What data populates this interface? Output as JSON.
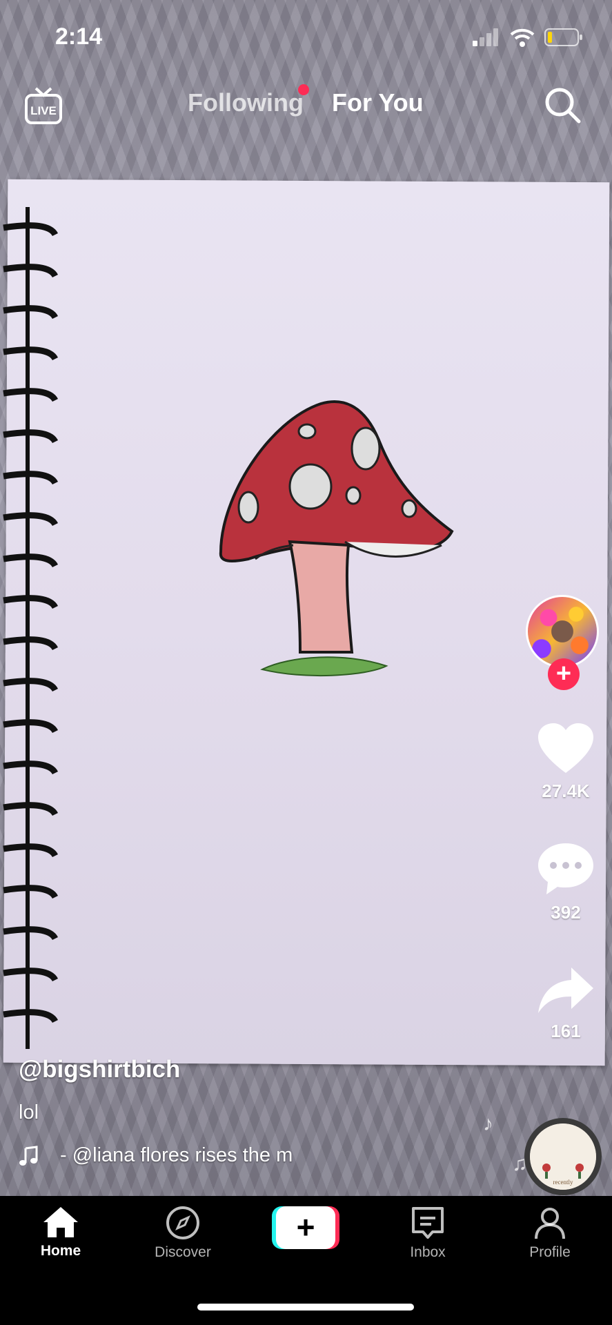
{
  "status_bar": {
    "time": "2:14"
  },
  "top_nav": {
    "live_label": "LIVE",
    "following_label": "Following",
    "for_you_label": "For You"
  },
  "side_actions": {
    "likes": "27.4K",
    "comments": "392",
    "shares": "161"
  },
  "video": {
    "username": "@bigshirtbich",
    "caption": "lol",
    "music_text": "- @liana flores    rises the m",
    "disc_label": "recently"
  },
  "bottom_nav": {
    "home": "Home",
    "discover": "Discover",
    "inbox": "Inbox",
    "profile": "Profile"
  },
  "colors": {
    "accent": "#fe2c55",
    "create_left": "#25f4ee",
    "create_right": "#fe2c55"
  },
  "icons": [
    "live-icon",
    "search-icon",
    "heart-icon",
    "comment-icon",
    "share-icon",
    "music-note-icon",
    "home-icon",
    "compass-icon",
    "plus-icon",
    "inbox-icon",
    "profile-icon",
    "signal-icon",
    "wifi-icon",
    "battery-icon"
  ]
}
